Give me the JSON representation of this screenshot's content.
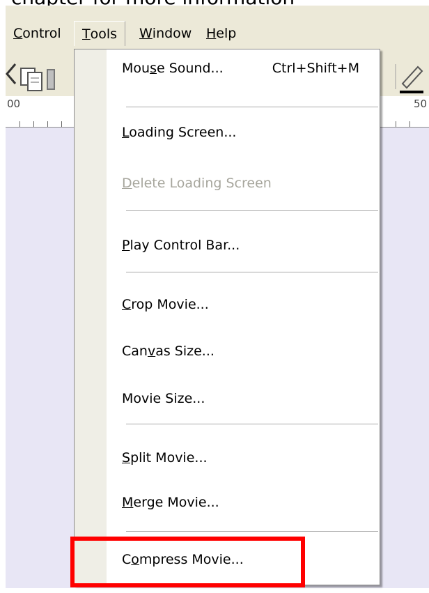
{
  "document": {
    "text": "chapter for more information"
  },
  "menubar": {
    "items": [
      {
        "label": "Control",
        "mnemonic_index": 0
      },
      {
        "label": "Tools",
        "mnemonic_index": 0
      },
      {
        "label": "Window",
        "mnemonic_index": 0
      },
      {
        "label": "Help",
        "mnemonic_index": 0
      }
    ],
    "active": "Tools"
  },
  "ruler": {
    "left_label": "00",
    "right_label": "50"
  },
  "tools_menu": {
    "items": [
      {
        "label": "Mouse Sound...",
        "mnemonic_index": 3,
        "shortcut": "Ctrl+Shift+M",
        "enabled": true
      },
      {
        "label": "Loading Screen...",
        "mnemonic_index": 0,
        "enabled": true
      },
      {
        "label": "Delete Loading Screen",
        "mnemonic_index": 0,
        "enabled": false
      },
      {
        "label": "Play Control Bar...",
        "mnemonic_index": 0,
        "enabled": true
      },
      {
        "label": "Crop Movie...",
        "mnemonic_index": 0,
        "enabled": true
      },
      {
        "label": "Canvas Size...",
        "mnemonic_index": 3,
        "enabled": true
      },
      {
        "label": "Movie Size...",
        "mnemonic_index": -1,
        "enabled": true
      },
      {
        "label": "Split Movie...",
        "mnemonic_index": 0,
        "enabled": true
      },
      {
        "label": "Merge Movie...",
        "mnemonic_index": 0,
        "enabled": true
      },
      {
        "label": "Compress Movie...",
        "mnemonic_index": 1,
        "enabled": true
      }
    ]
  },
  "annotation": {
    "highlight_color": "#ff0000",
    "highlighted_item": "Compress Movie..."
  },
  "colors": {
    "menubar_bg": "#ece9d8",
    "canvas_bg": "#e8e6f5",
    "disabled_text": "#a7a69d"
  }
}
